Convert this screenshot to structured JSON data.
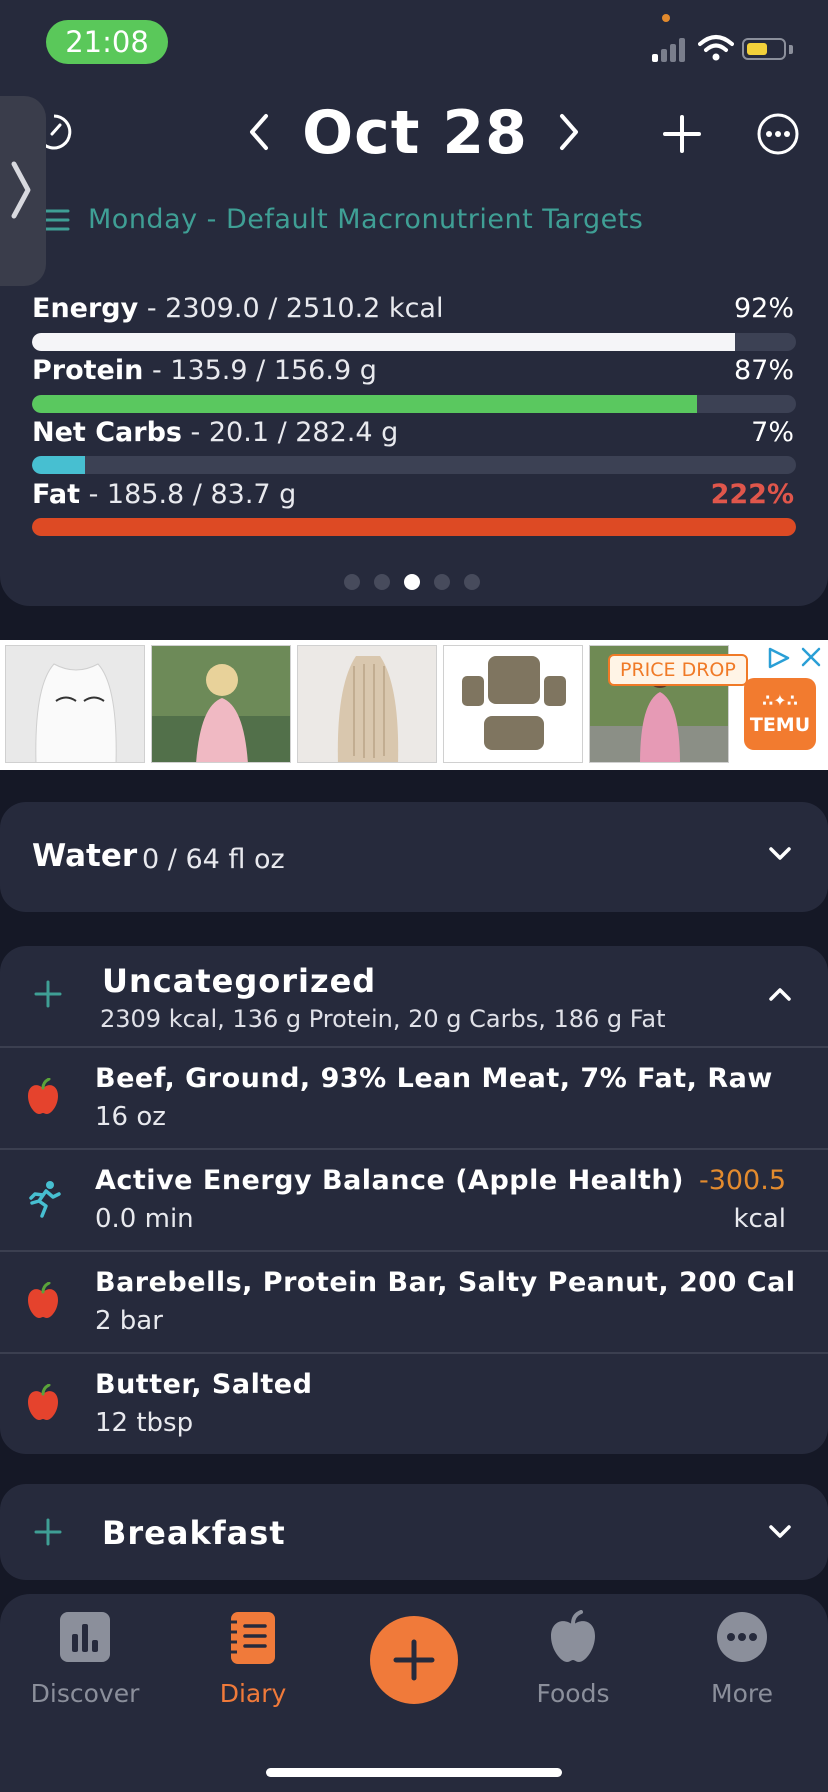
{
  "status_bar": {
    "time": "21:08"
  },
  "header": {
    "date": "Oct 28",
    "targets_label": "Monday - Default Macronutrient Targets"
  },
  "nutrients": [
    {
      "name": "Energy",
      "detail": " - 2309.0 / 2510.2 kcal",
      "percent": "92%",
      "progress": 0.92,
      "color": "#f5f5f8"
    },
    {
      "name": "Protein",
      "detail": " - 135.9 / 156.9 g",
      "percent": "87%",
      "progress": 0.87,
      "color": "#5ac85f"
    },
    {
      "name": "Net Carbs",
      "detail": " - 20.1 / 282.4 g",
      "percent": "7%",
      "progress": 0.07,
      "color": "#47bfd1"
    },
    {
      "name": "Fat",
      "detail": " - 185.8 / 83.7 g",
      "percent": "222%",
      "progress": 1.0,
      "color": "#dd4a24",
      "percent_color": "#e0564b"
    }
  ],
  "pager": {
    "count": 5,
    "active_index": 2
  },
  "ad": {
    "badge": "PRICE DROP",
    "brand": "TEMU",
    "brand_glyphs": "∴✦∴"
  },
  "water": {
    "title": "Water",
    "value": "0 / 64 fl oz"
  },
  "uncategorized": {
    "title": "Uncategorized",
    "summary": "2309 kcal, 136 g Protein, 20 g Carbs, 186 g Fat",
    "items": [
      {
        "icon": "apple-icon",
        "name": "Beef, Ground, 93% Lean Meat, 7% Fat, Raw",
        "qty": "16 oz"
      },
      {
        "icon": "running-icon",
        "name": "Active Energy Balance (Apple Health)",
        "qty": "0.0 min",
        "value": "-300.5",
        "unit": "kcal"
      },
      {
        "icon": "apple-icon",
        "name": "Barebells, Protein Bar, Salty Peanut, 200 Cal",
        "qty": "2 bar"
      },
      {
        "icon": "apple-icon",
        "name": "Butter, Salted",
        "qty": "12 tbsp"
      }
    ]
  },
  "breakfast": {
    "title": "Breakfast"
  },
  "tabs": {
    "discover": "Discover",
    "diary": "Diary",
    "foods": "Foods",
    "more": "More"
  },
  "colors": {
    "accent": "#f07a3a",
    "teal": "#3f9f95",
    "card": "#262a3c",
    "background": "#151826"
  }
}
